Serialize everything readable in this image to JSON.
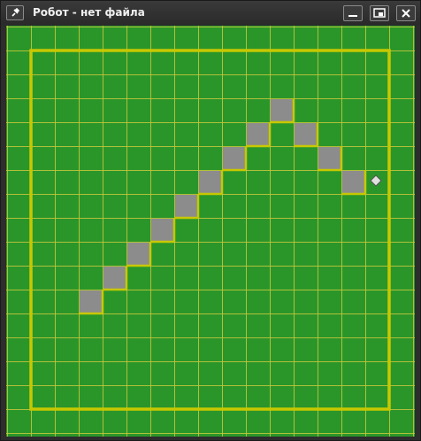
{
  "window": {
    "title": "Робот - нет файла",
    "pin_icon": "pin-icon",
    "minimize_icon": "minimize-icon",
    "restore_icon": "restore-icon",
    "close_icon": "close-icon"
  },
  "field": {
    "background_color": "#2a962a",
    "grid_line_color": "#c8c83c",
    "wall_color": "#c8c800",
    "painted_cell_color": "#8c8c8c",
    "robot_icon": "diamond-icon",
    "robot_color": "#e0e0e0",
    "painted_cells": [
      {
        "col": 10,
        "row": 2
      },
      {
        "col": 9,
        "row": 3
      },
      {
        "col": 11,
        "row": 3
      },
      {
        "col": 8,
        "row": 4
      },
      {
        "col": 12,
        "row": 4
      },
      {
        "col": 7,
        "row": 5
      },
      {
        "col": 13,
        "row": 5
      },
      {
        "col": 6,
        "row": 6
      },
      {
        "col": 5,
        "row": 7
      },
      {
        "col": 4,
        "row": 8
      },
      {
        "col": 3,
        "row": 9
      },
      {
        "col": 2,
        "row": 10
      }
    ],
    "robot_position": {
      "col": 14,
      "row": 5
    }
  }
}
